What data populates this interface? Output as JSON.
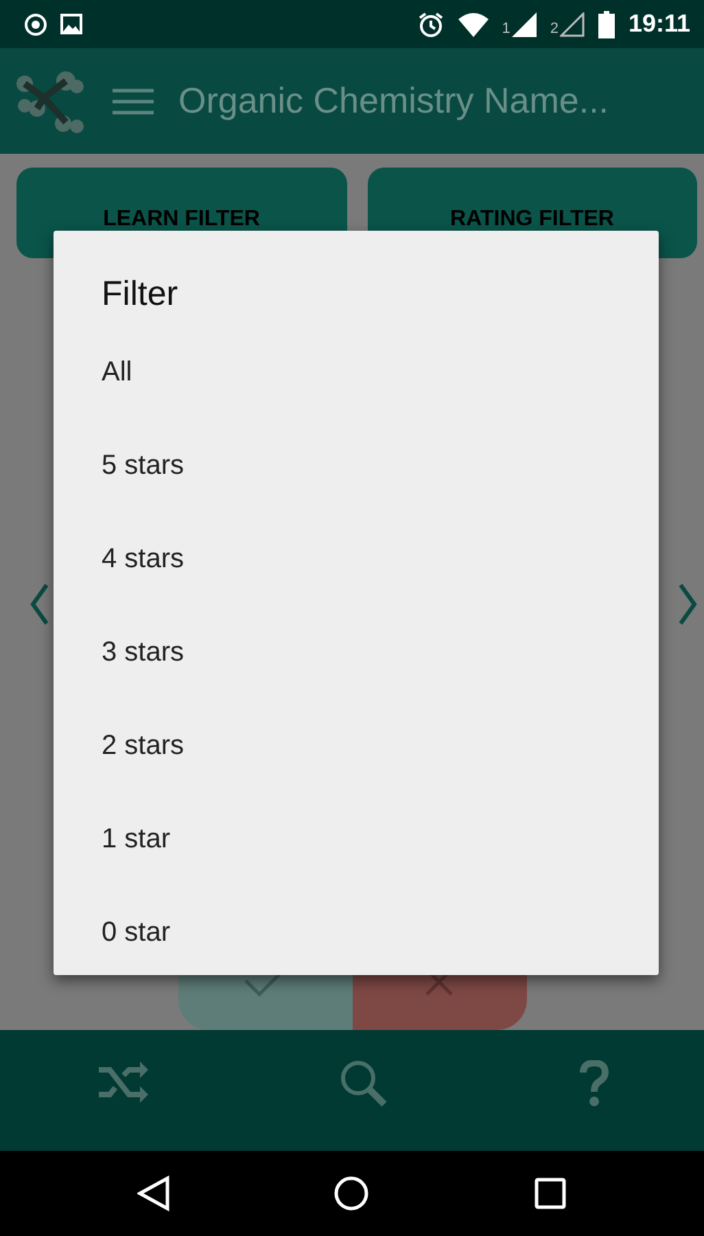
{
  "status_bar": {
    "sims": [
      {
        "label": "1",
        "kind": "filled"
      },
      {
        "label": "2",
        "kind": "empty"
      }
    ],
    "time": "19:11"
  },
  "app_bar": {
    "title": "Organic Chemistry Name..."
  },
  "filter_buttons": [
    "LEARN FILTER",
    "RATING FILTER"
  ],
  "dialog": {
    "title": "Filter",
    "options": [
      "All",
      "5 stars",
      "4 stars",
      "3 stars",
      "2 stars",
      "1 star",
      "0 star"
    ]
  }
}
